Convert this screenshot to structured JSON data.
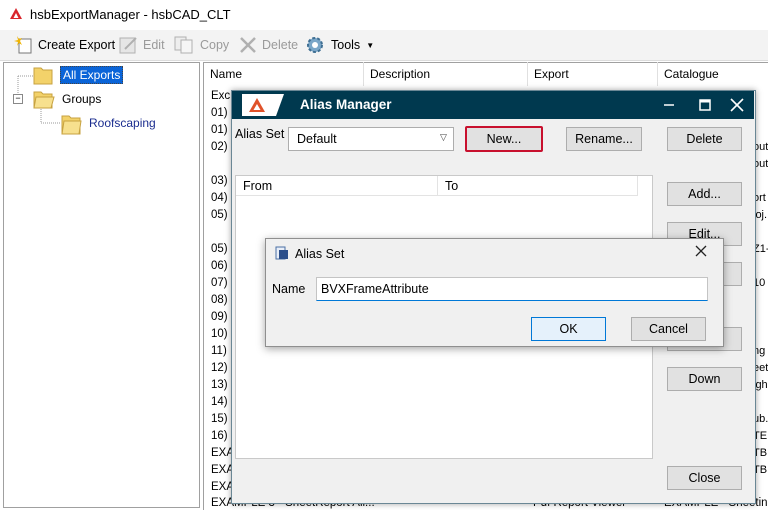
{
  "window": {
    "title": "hsbExportManager - hsbCAD_CLT"
  },
  "toolbar": {
    "create_export": "Create Export",
    "edit": "Edit",
    "copy": "Copy",
    "delete": "Delete",
    "tools": "Tools"
  },
  "tree": {
    "all_exports": "All Exports",
    "groups": "Groups",
    "roofscaping": "Roofscaping"
  },
  "list": {
    "columns": [
      "Name",
      "Description",
      "Export",
      "Catalogue"
    ],
    "rows": [
      "Exc",
      "01)",
      "01)",
      "02)",
      "03)",
      "04)",
      "05)",
      "05)",
      "06)",
      "07)",
      "08)",
      "09)",
      "10)",
      "11)",
      "12)",
      "13)",
      "14)",
      "15)",
      "16)",
      "EXA",
      "EXA",
      "EXA"
    ],
    "last_row": {
      "name": "EXAMPLE 3 - SheetReport All...",
      "export": "Pdf Report Viewer",
      "catalogue": "EXAMPLE - Sheetin..."
    },
    "right_fragments": [
      "out",
      "ort",
      "ioj.",
      "Z1-",
      "10",
      "ng",
      "eet",
      "igh",
      "ub.",
      "TE",
      "TB",
      "TB"
    ]
  },
  "alias_manager": {
    "title": "Alias Manager",
    "alias_set_label": "Alias Set",
    "alias_set_value": "Default",
    "new_button": "New...",
    "rename_button": "Rename...",
    "delete_button": "Delete",
    "add_button": "Add...",
    "edit_button": "Edit...",
    "remove_fragment": "e",
    "down_button": "Down",
    "close_button": "Close",
    "columns": {
      "from": "From",
      "to": "To"
    }
  },
  "alias_set_dialog": {
    "title": "Alias Set",
    "name_label": "Name",
    "name_value": "BVXFrameAttribute",
    "ok_button": "OK",
    "cancel_button": "Cancel"
  },
  "colors": {
    "alias_title_bar": "#00394f",
    "selection": "#0a64d8",
    "highlight_border": "#c8102e",
    "input_focus": "#0078d7"
  }
}
